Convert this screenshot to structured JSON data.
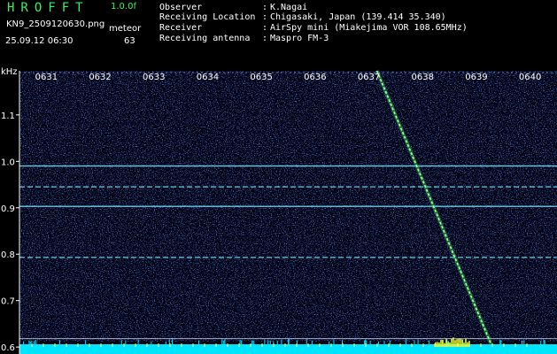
{
  "header": {
    "brand": "HROFFT",
    "version": "1.0.0f",
    "filename": "KN9_2509120630.png",
    "mode": "meteor",
    "datetime": "25.09.12 06:30",
    "count": "63",
    "info": [
      {
        "key": "Observer",
        "value": "K.Nagai"
      },
      {
        "key": "Receiving Location",
        "value": "Chigasaki, Japan (139.414 35.340)"
      },
      {
        "key": "Receiver",
        "value": "AirSpy mini (Miakejima VOR 108.65MHz)"
      },
      {
        "key": "Receiving antenna",
        "value": "Maspro FM-3"
      }
    ]
  },
  "chart_data": {
    "type": "heatmap",
    "ylabel": "kHz",
    "x_ticks": [
      "0631",
      "0632",
      "0633",
      "0634",
      "0635",
      "0636",
      "0637",
      "0638",
      "0639",
      "0640"
    ],
    "y_ticks": [
      1.1,
      1.0,
      0.9,
      0.8,
      0.7,
      0.6
    ],
    "ylim": [
      0.585,
      1.195
    ],
    "xlim": [
      0,
      10
    ],
    "horizontal_lines_khz": [
      0.99,
      0.945,
      0.903,
      0.793,
      0.618,
      0.6
    ],
    "echo_trace": {
      "start": [
        6.65,
        1.195
      ],
      "end": [
        8.85,
        0.585
      ]
    },
    "colors": {
      "background": "#000010",
      "noise": "#1a3aa8",
      "line": "#6fe0ff",
      "axis": "#ffffff",
      "text_green": "#38f05a",
      "bottom_band": "#00e5ff",
      "burst": "#f3ff2a"
    }
  }
}
